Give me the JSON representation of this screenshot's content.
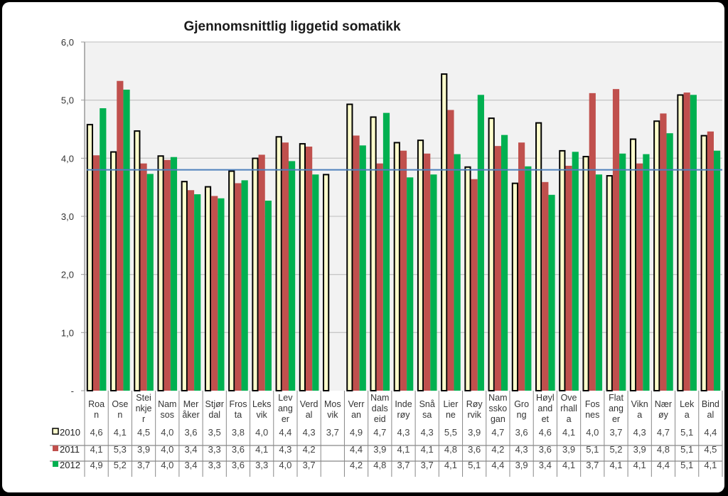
{
  "chart_data": {
    "type": "bar",
    "title": "Gjennomsnittlig liggetid somatikk",
    "xlabel": "",
    "ylabel": "",
    "ylim": [
      0,
      6
    ],
    "yticks": [
      "-",
      "1,0",
      "2,0",
      "3,0",
      "4,0",
      "5,0",
      "6,0"
    ],
    "ytick_values": [
      0,
      1,
      2,
      3,
      4,
      5,
      6
    ],
    "grid": true,
    "legend_placement": "data-table-left",
    "reference_line": {
      "value": 3.8,
      "color": "#4f81bd"
    },
    "categories": [
      [
        "Roa",
        "n"
      ],
      [
        "Ose",
        "n"
      ],
      [
        "Stei",
        "nkje",
        "r"
      ],
      [
        "Nam",
        "sos"
      ],
      [
        "Mer",
        "åker"
      ],
      [
        "Stjør",
        "dal"
      ],
      [
        "Fros",
        "ta"
      ],
      [
        "Leks",
        "vik"
      ],
      [
        "Lev",
        "ang",
        "er"
      ],
      [
        "Verd",
        "al"
      ],
      [
        "Mos",
        "vik"
      ],
      [
        "Verr",
        "an"
      ],
      [
        "Nam",
        "dals",
        "eid"
      ],
      [
        "Inde",
        "røy"
      ],
      [
        "Snå",
        "sa"
      ],
      [
        "Lier",
        "ne"
      ],
      [
        "Røy",
        "rvik"
      ],
      [
        "Nam",
        "ssko",
        "gan"
      ],
      [
        "Gro",
        "ng"
      ],
      [
        "Høyl",
        "and",
        "et"
      ],
      [
        "Ove",
        "rhall",
        "a"
      ],
      [
        "Fos",
        "nes"
      ],
      [
        "Flat",
        "ang",
        "er"
      ],
      [
        "Vikn",
        "a"
      ],
      [
        "Nær",
        "øy"
      ],
      [
        "Lek",
        "a"
      ],
      [
        "Bind",
        "al"
      ]
    ],
    "category_names": [
      "Roan",
      "Osen",
      "Steinkjer",
      "Namsos",
      "Meråker",
      "Stjørdal",
      "Frosta",
      "Leksvik",
      "Levanger",
      "Verdal",
      "Mosvik",
      "Verran",
      "Namdalseid",
      "Inderøy",
      "Snåsa",
      "Lierne",
      "Røyrvik",
      "Namsskogan",
      "Grong",
      "Høylandet",
      "Overhalla",
      "Fosnes",
      "Flatanger",
      "Vikna",
      "Nærøy",
      "Leka",
      "Bindal"
    ],
    "series": [
      {
        "name": "2010",
        "color": "#ffffcc",
        "stroke": "#000000",
        "values": [
          4.59,
          4.12,
          4.48,
          4.05,
          3.61,
          3.52,
          3.79,
          4.01,
          4.38,
          4.26,
          3.73,
          4.94,
          4.72,
          4.28,
          4.32,
          5.46,
          3.86,
          4.7,
          3.58,
          4.62,
          4.14,
          4.04,
          3.71,
          4.34,
          4.65,
          5.1,
          4.4
        ],
        "labels": [
          "4,6",
          "4,1",
          "4,5",
          "4,0",
          "3,6",
          "3,5",
          "3,8",
          "4,0",
          "4,4",
          "4,3",
          "3,7",
          "4,9",
          "4,7",
          "4,3",
          "4,3",
          "5,5",
          "3,9",
          "4,7",
          "3,6",
          "4,6",
          "4,1",
          "4,0",
          "3,7",
          "4,3",
          "4,7",
          "5,1",
          "4,4"
        ]
      },
      {
        "name": "2011",
        "color": "#c0504d",
        "stroke": "none",
        "values": [
          4.05,
          5.33,
          3.91,
          3.97,
          3.45,
          3.35,
          3.57,
          4.06,
          4.27,
          4.2,
          null,
          4.39,
          3.91,
          4.13,
          4.08,
          4.83,
          3.64,
          4.21,
          4.27,
          3.59,
          3.87,
          5.12,
          5.19,
          3.91,
          4.77,
          5.13,
          4.46
        ],
        "labels": [
          "4,1",
          "5,3",
          "3,9",
          "4,0",
          "3,4",
          "3,3",
          "3,6",
          "4,1",
          "4,3",
          "4,2",
          "",
          "4,4",
          "3,9",
          "4,1",
          "4,1",
          "4,8",
          "3,6",
          "4,2",
          "4,3",
          "3,6",
          "3,9",
          "5,1",
          "5,2",
          "3,9",
          "4,8",
          "5,1",
          "4,5"
        ]
      },
      {
        "name": "2012",
        "color": "#00b050",
        "stroke": "none",
        "values": [
          4.86,
          5.18,
          3.73,
          4.02,
          3.38,
          3.31,
          3.62,
          3.27,
          3.95,
          3.72,
          null,
          4.22,
          4.78,
          3.67,
          3.72,
          4.07,
          5.09,
          4.4,
          3.86,
          3.37,
          4.11,
          3.72,
          4.08,
          4.07,
          4.43,
          5.09,
          4.13
        ],
        "labels": [
          "4,9",
          "5,2",
          "3,7",
          "4,0",
          "3,4",
          "3,3",
          "3,6",
          "3,3",
          "4,0",
          "3,7",
          "",
          "4,2",
          "4,8",
          "3,7",
          "3,7",
          "4,1",
          "5,1",
          "4,4",
          "3,9",
          "3,4",
          "4,1",
          "3,7",
          "4,1",
          "4,1",
          "4,4",
          "5,1",
          "4,1"
        ]
      }
    ]
  },
  "style": {
    "plot_bg": "#f2f2f2",
    "gridline": "#c8c8c8",
    "axis": "#999999",
    "table_line": "#888888"
  }
}
